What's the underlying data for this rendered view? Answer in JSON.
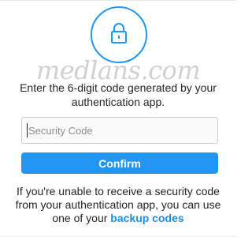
{
  "icon": {
    "name": "lock-icon",
    "color": "#2196f3"
  },
  "watermark": "medlans.com",
  "instructions": "Enter the 6-digit code generated by your authentication app.",
  "security_code": {
    "value": "",
    "placeholder": "Security Code"
  },
  "confirm_button": {
    "label": "Confirm",
    "color": "#2196f3"
  },
  "help": {
    "text": "If you're unable to receive a security code from your authentication app, you can use one of your ",
    "link_label": "backup codes",
    "link_color": "#1a8fe3"
  }
}
